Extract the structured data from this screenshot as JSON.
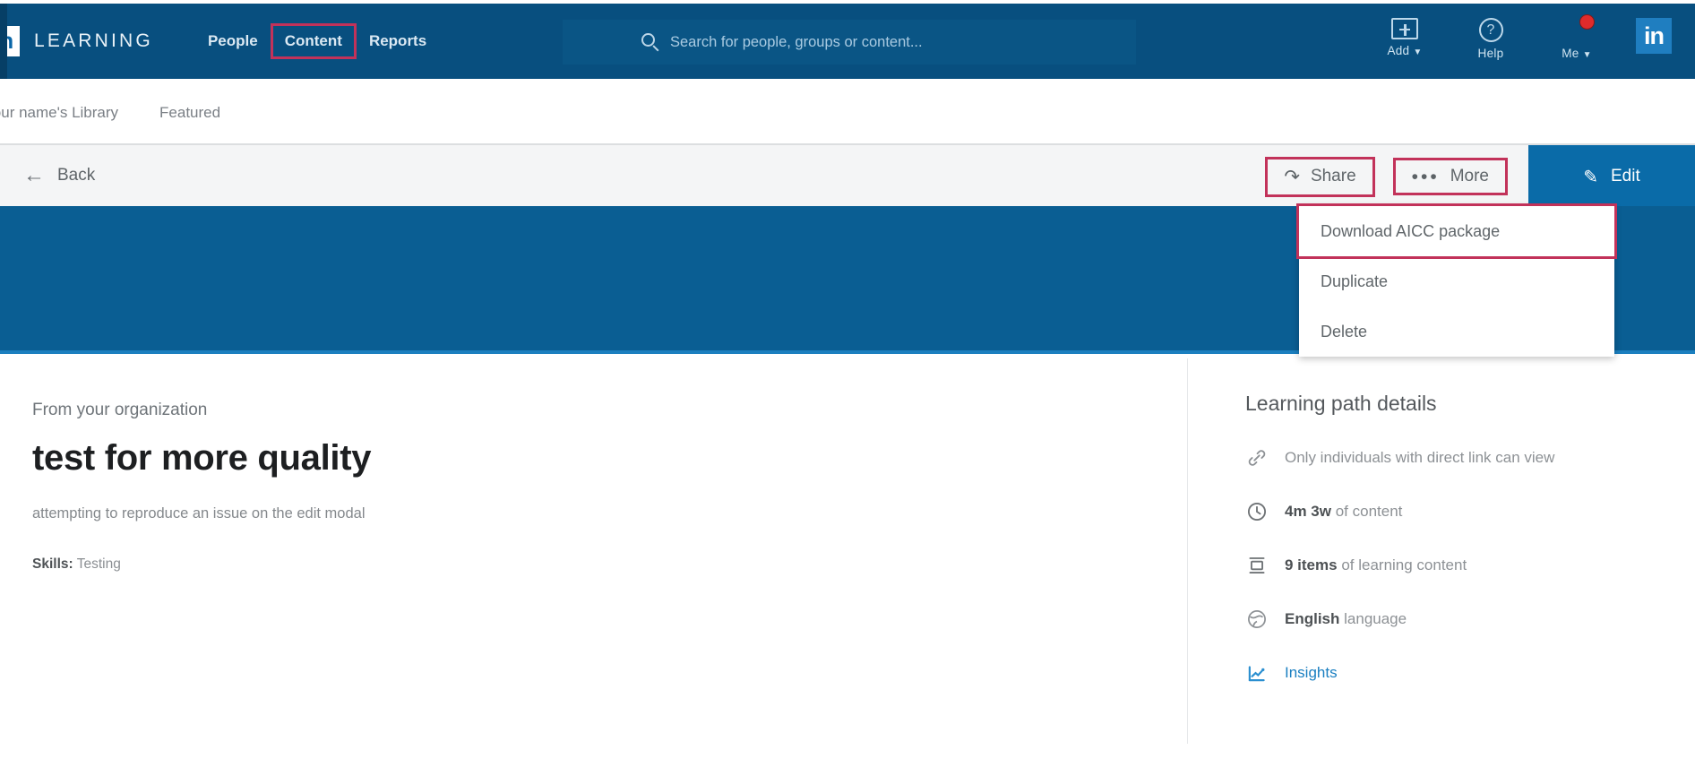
{
  "topnav": {
    "logo_text": "in",
    "brand_word": "LEARNING",
    "links": [
      {
        "label": "People",
        "highlighted": false
      },
      {
        "label": "Content",
        "highlighted": true
      },
      {
        "label": "Reports",
        "highlighted": false
      }
    ],
    "search": {
      "placeholder": "Search for people, groups or content...",
      "value": "",
      "icon": "search-icon"
    },
    "right_items": [
      {
        "label": "Add",
        "icon": "add-icon",
        "caret": "▼"
      },
      {
        "label": "Help",
        "icon": "question-mark-icon",
        "caret": ""
      },
      {
        "label": "Me",
        "icon": "avatar-icon",
        "caret": "▼"
      }
    ],
    "linkedin_square": "in",
    "accent_blue": "#084f7f",
    "highlight_red": "#c2325a"
  },
  "breadcrumb": {
    "items": [
      {
        "label": "Your name's Library"
      },
      {
        "label": "Featured"
      }
    ]
  },
  "actionbar": {
    "back_label": "Back",
    "back_icon": "arrow-left-icon",
    "share_label": "Share",
    "share_icon": "share-arrow-icon",
    "more_label": "More",
    "more_icon": "ellipsis-icon",
    "edit_label": "Edit",
    "edit_icon": "pencil-icon"
  },
  "more_menu": {
    "items": [
      {
        "label": "Download AICC package",
        "highlighted": true
      },
      {
        "label": "Duplicate",
        "highlighted": false
      },
      {
        "label": "Delete",
        "highlighted": false
      }
    ]
  },
  "main": {
    "eyebrow": "From your organization",
    "title": "test for more quality",
    "description": "attempting to reproduce an issue on the edit modal",
    "skills_label": "Skills:",
    "skills_value": "Testing"
  },
  "sidebar": {
    "title": "Learning path details",
    "details": [
      {
        "icon": "link-icon",
        "text": "Only individuals with direct link can view",
        "strong": ""
      },
      {
        "icon": "clock-icon",
        "strong": "4m 3w",
        "text": " of content"
      },
      {
        "icon": "stack-icon",
        "strong": "9 items",
        "text": " of learning content"
      },
      {
        "icon": "globe-icon",
        "strong": "English",
        "text": " language"
      }
    ],
    "insights_label": "Insights",
    "insights_icon": "chart-line-icon",
    "insights_color": "#1a7fc1"
  }
}
